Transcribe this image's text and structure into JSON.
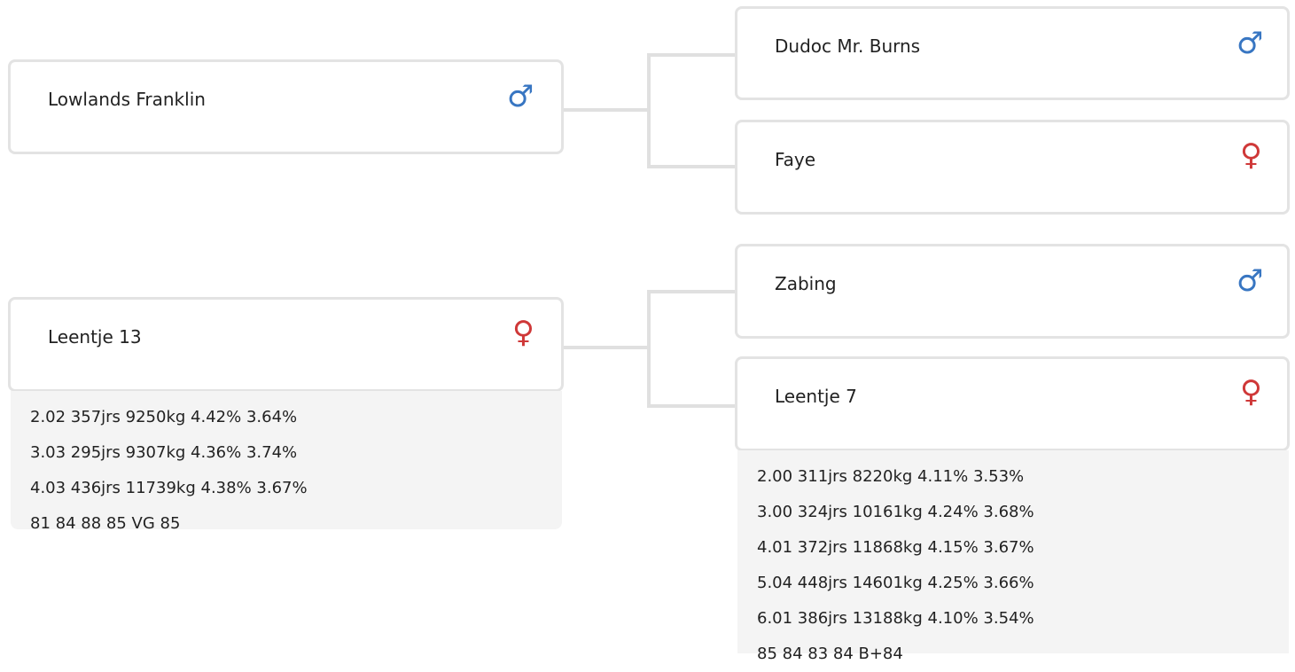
{
  "colors": {
    "male": "#3876c2",
    "female": "#cf3838"
  },
  "animals": {
    "sire": {
      "name": "Lowlands Franklin",
      "sex_icon": "♂",
      "sex": "male-icon"
    },
    "dam": {
      "name": "Leentje 13",
      "sex_icon": "♀",
      "sex": "female-icon",
      "stats": [
        "2.02 357jrs 9250kg 4.42% 3.64%",
        "3.03 295jrs 9307kg 4.36% 3.74%",
        "4.03 436jrs 11739kg 4.38% 3.67%",
        "81 84 88 85 VG 85"
      ]
    },
    "sire_sire": {
      "name": "Dudoc Mr. Burns",
      "sex_icon": "♂",
      "sex": "male-icon"
    },
    "sire_dam": {
      "name": "Faye",
      "sex_icon": "♀",
      "sex": "female-icon"
    },
    "dam_sire": {
      "name": "Zabing",
      "sex_icon": "♂",
      "sex": "male-icon"
    },
    "dam_dam": {
      "name": "Leentje 7",
      "sex_icon": "♀",
      "sex": "female-icon",
      "stats": [
        "2.00 311jrs 8220kg 4.11% 3.53%",
        "3.00 324jrs 10161kg 4.24% 3.68%",
        "4.01 372jrs 11868kg 4.15% 3.67%",
        "5.04 448jrs 14601kg 4.25% 3.66%",
        "6.01 386jrs 13188kg 4.10% 3.54%",
        "85 84 83 84 B+84"
      ]
    }
  }
}
